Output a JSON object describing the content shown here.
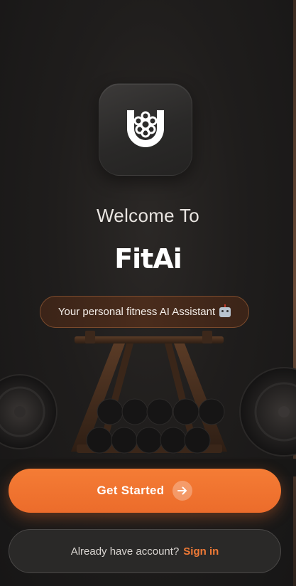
{
  "welcome": {
    "heading": "Welcome To",
    "brand_name": "FitAi",
    "tagline": "Your personal fitness AI Assistant",
    "tagline_icon": "robot-icon"
  },
  "actions": {
    "get_started_label": "Get Started",
    "get_started_icon": "arrow-right-icon",
    "signin_prompt": "Already have account?",
    "signin_link": "Sign in"
  },
  "colors": {
    "accent": "#EC6C2B",
    "background": "#1D1B1A",
    "text": "#FFFFFF"
  }
}
